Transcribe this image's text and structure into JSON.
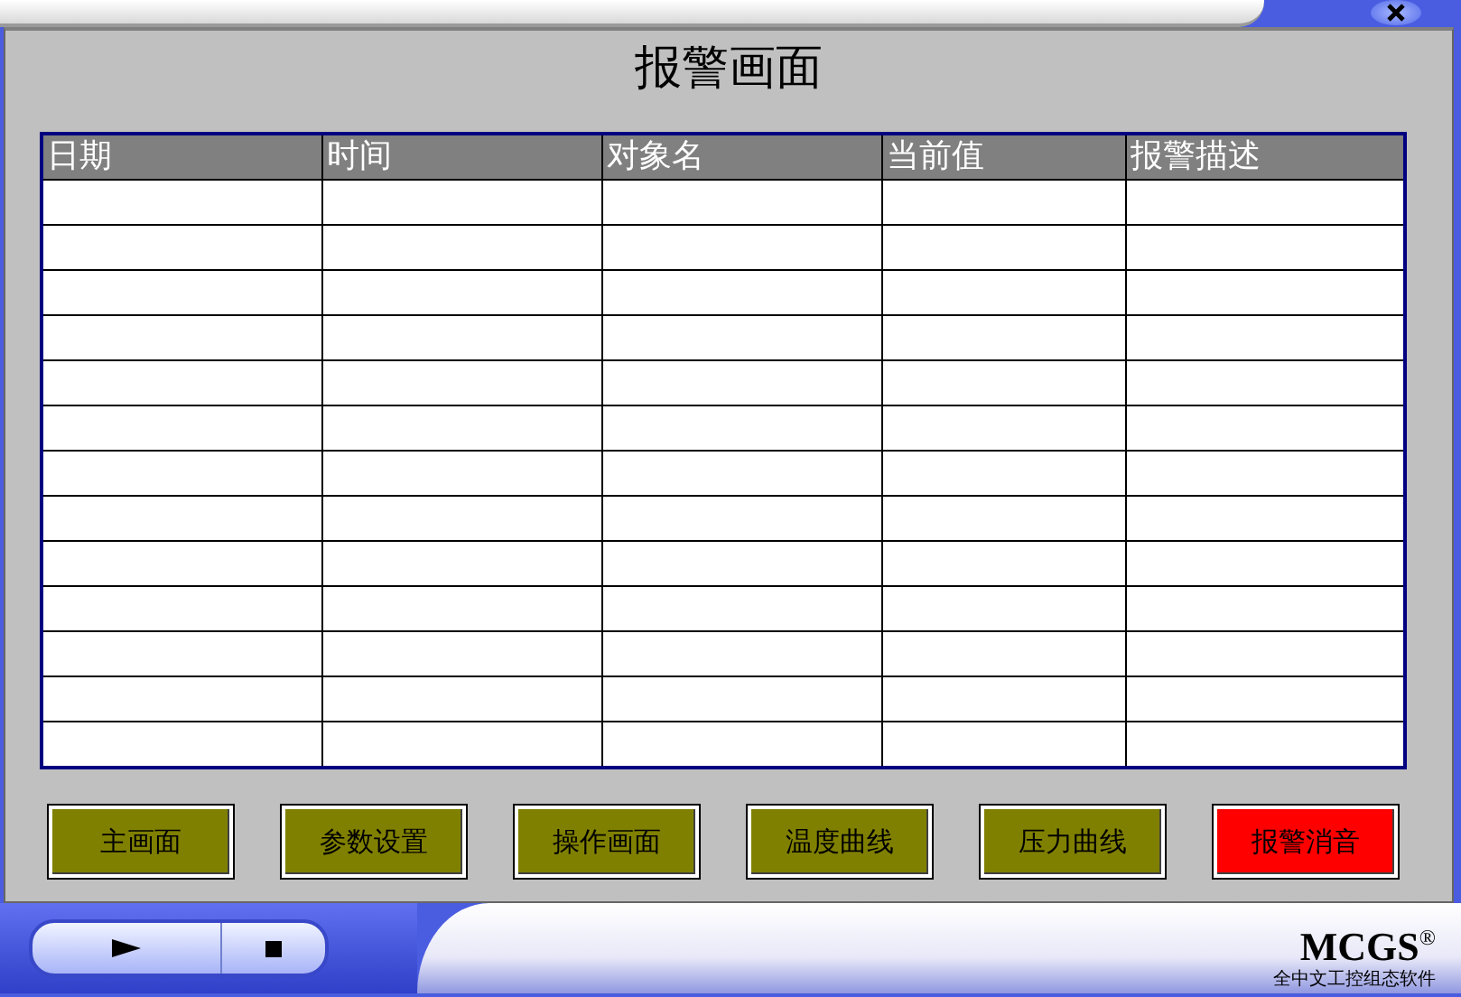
{
  "window": {
    "title": "报警画面"
  },
  "table": {
    "columns": [
      "日期",
      "时间",
      "对象名",
      "当前值",
      "报警描述"
    ]
  },
  "buttons": [
    {
      "label": "主画面",
      "color": "#808000"
    },
    {
      "label": "参数设置",
      "color": "#808000"
    },
    {
      "label": "操作画面",
      "color": "#808000"
    },
    {
      "label": "温度曲线",
      "color": "#808000"
    },
    {
      "label": "压力曲线",
      "color": "#808000"
    },
    {
      "label": "报警消音",
      "color": "#ff0000"
    }
  ],
  "logo": {
    "name": "MCGS$^{®}$",
    "tagline": "全中文工控组态软件"
  }
}
